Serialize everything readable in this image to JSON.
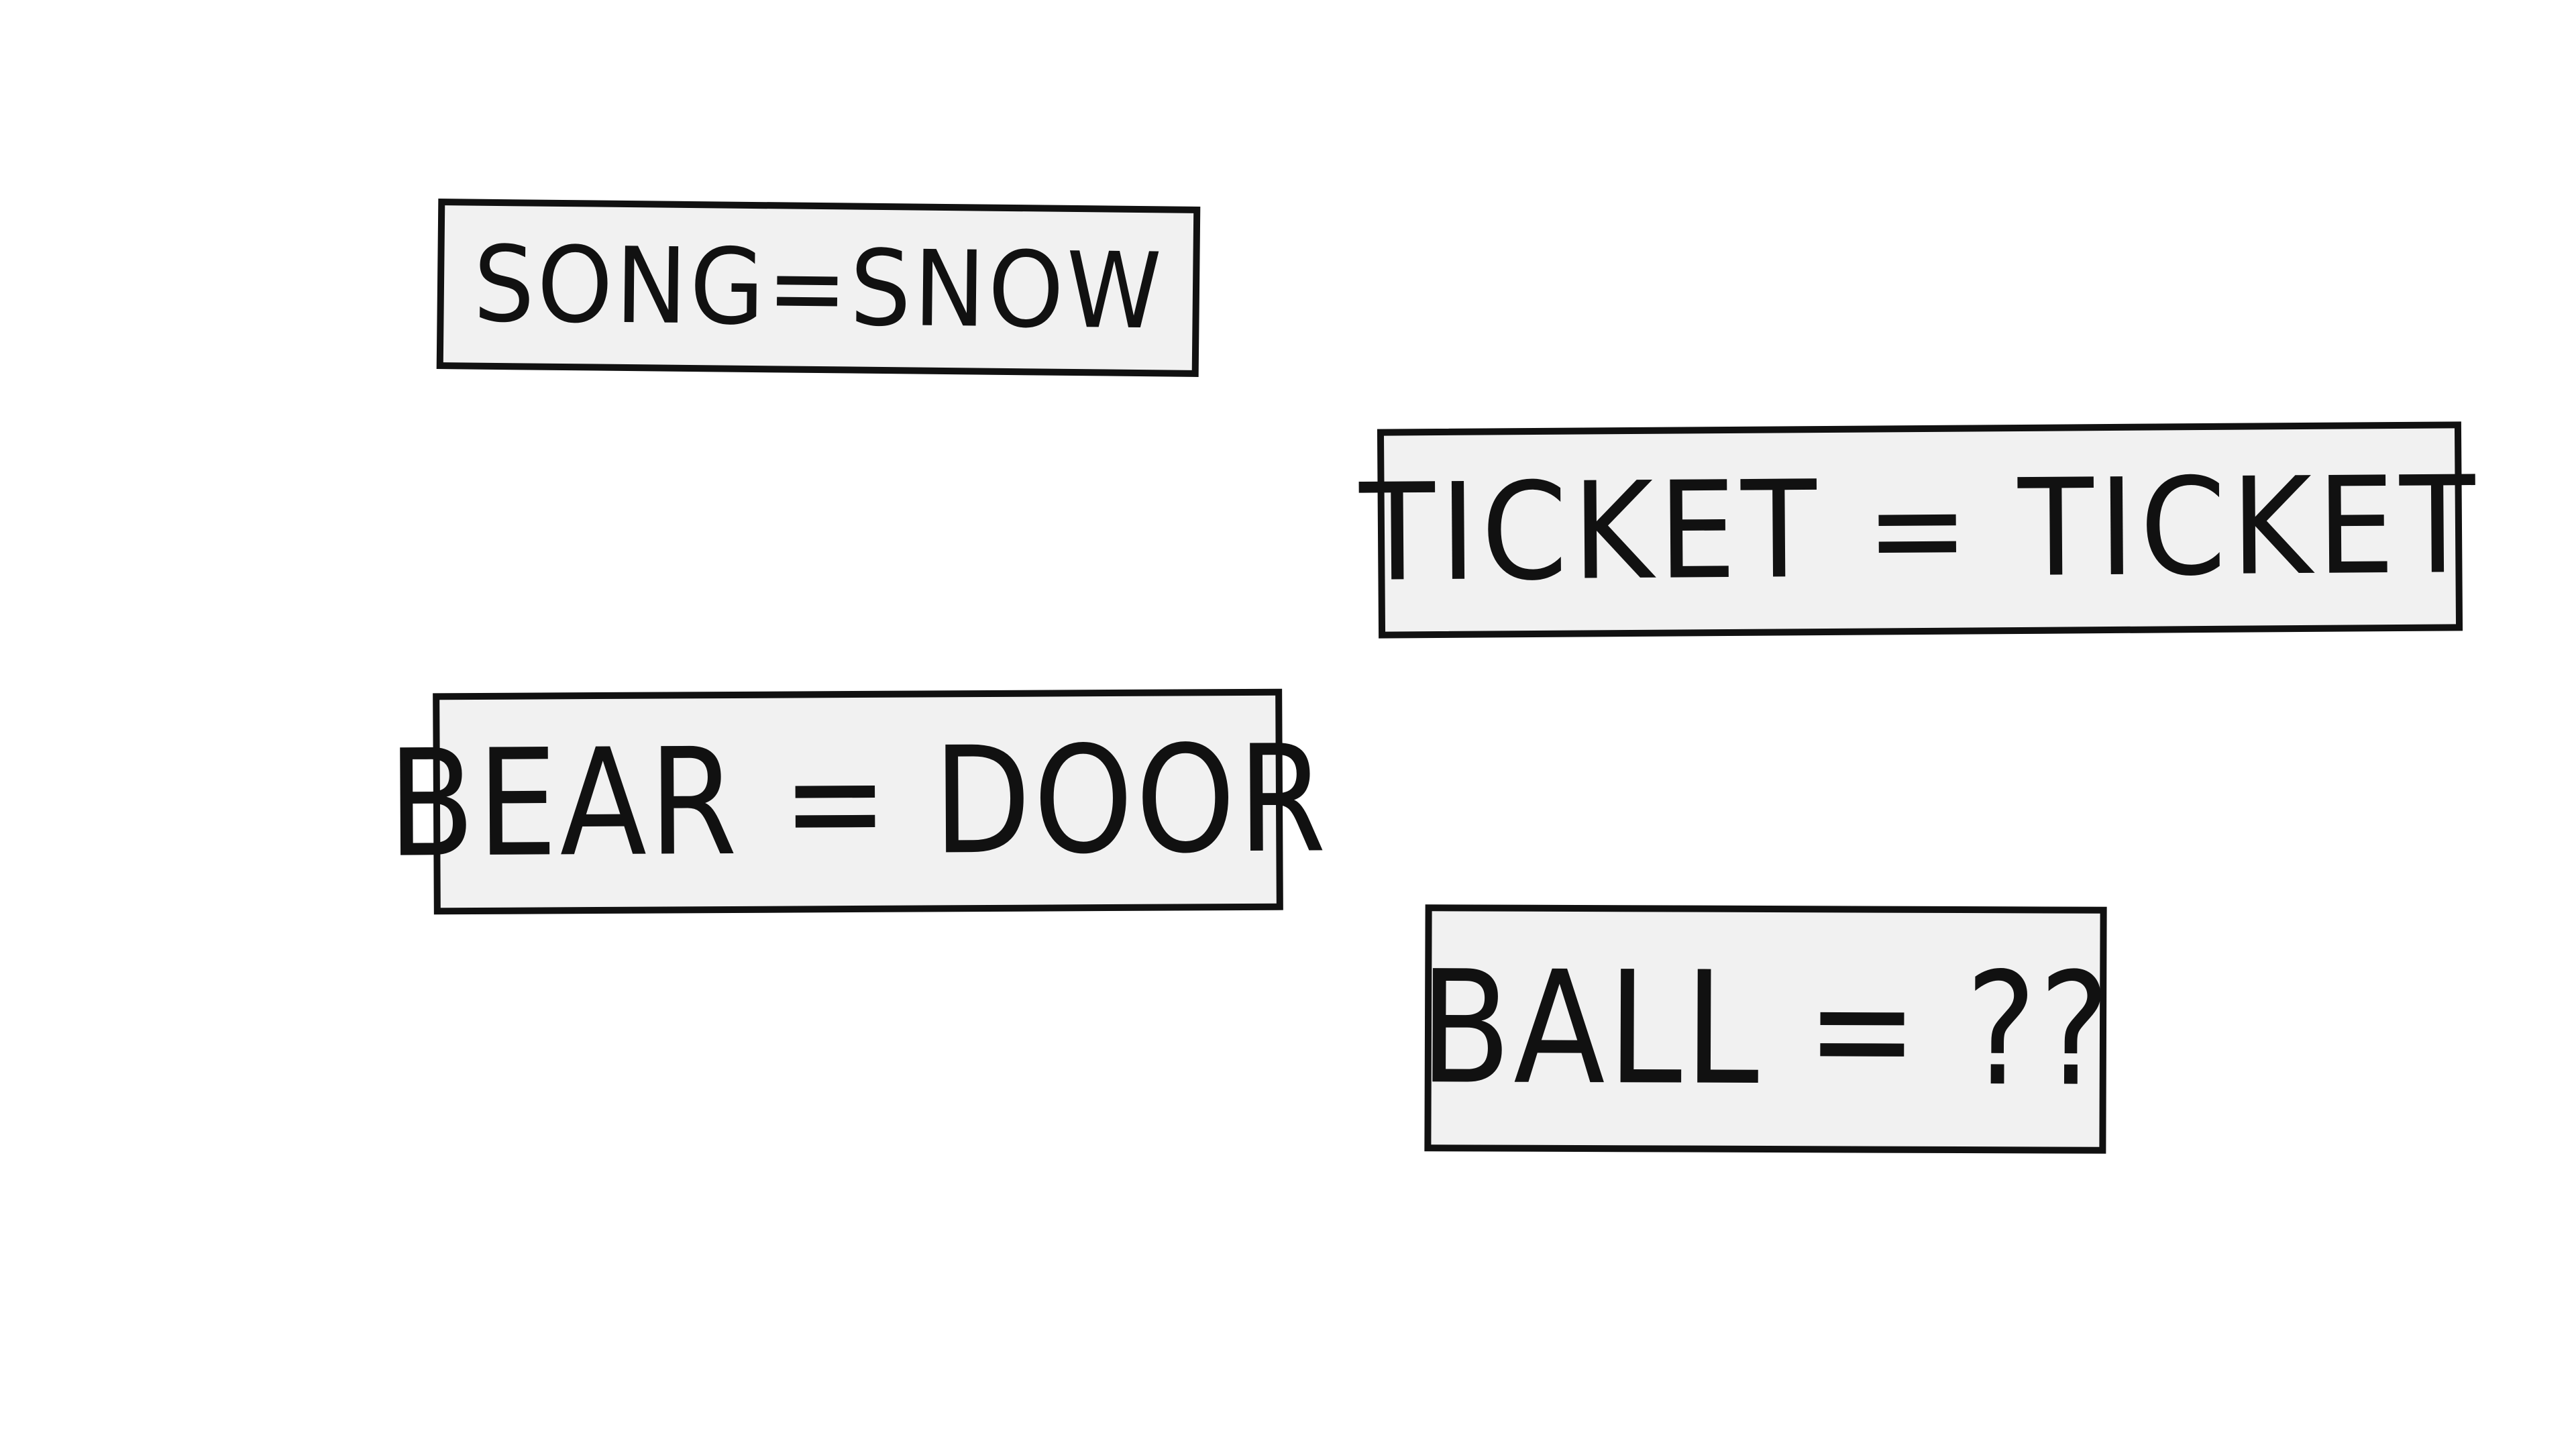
{
  "cards": [
    {
      "text": "SONG=SNOW"
    },
    {
      "text": "TICKET = TICKET"
    },
    {
      "text": "BEAR = DOOR"
    },
    {
      "text": "BALL = ??"
    }
  ],
  "colors": {
    "background": "#ffffff",
    "card_fill": "#f1f1f1",
    "ink": "#111111"
  }
}
